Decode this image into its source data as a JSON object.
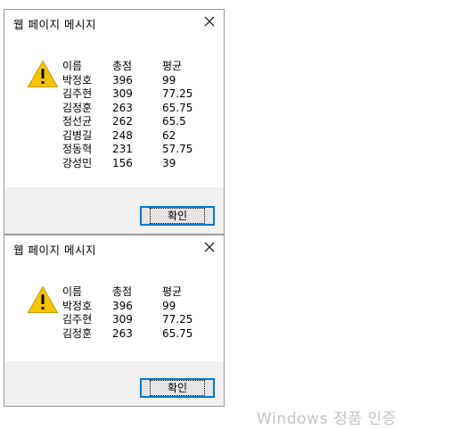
{
  "dialogs": [
    {
      "title": "웹 페이지 메시지",
      "headers": [
        "이름",
        "총점",
        "평균"
      ],
      "rows": [
        [
          "박정호",
          "396",
          "99"
        ],
        [
          "김주현",
          "309",
          "77.25"
        ],
        [
          "김정훈",
          "263",
          "65.75"
        ],
        [
          "정선균",
          "262",
          "65.5"
        ],
        [
          "김병길",
          "248",
          "62"
        ],
        [
          "정동혁",
          "231",
          "57.75"
        ],
        [
          "강성민",
          "156",
          "39"
        ]
      ],
      "ok_label": "확인",
      "icon": "warning-icon",
      "close_icon": "close-icon"
    },
    {
      "title": "웹 페이지 메시지",
      "headers": [
        "이름",
        "총점",
        "평균"
      ],
      "rows": [
        [
          "박정호",
          "396",
          "99"
        ],
        [
          "김주현",
          "309",
          "77.25"
        ],
        [
          "김정훈",
          "263",
          "65.75"
        ]
      ],
      "ok_label": "확인",
      "icon": "warning-icon",
      "close_icon": "close-icon"
    }
  ],
  "watermark": "Windows 정품 인증",
  "colors": {
    "warning_fill": "#f6c400",
    "button_border": "#0078d7",
    "footer_bg": "#f0f0f0",
    "watermark": "#c4c4c4"
  }
}
